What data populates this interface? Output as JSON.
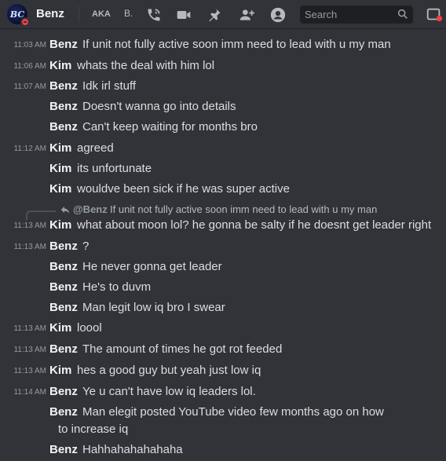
{
  "header": {
    "avatar_initials": "BC",
    "name": "Benz",
    "aka_label": "AKA",
    "aka_value": "B.",
    "search_placeholder": "Search"
  },
  "icons": {
    "call": "phone-call-icon",
    "video": "video-camera-icon",
    "pin": "pin-icon",
    "add_friend": "add-friend-icon",
    "profile": "user-profile-icon",
    "search": "search-icon",
    "inbox": "inbox-icon"
  },
  "colors": {
    "background": "#313338",
    "status_dnd": "#f23f43",
    "text": "#dbdee1",
    "muted": "#949ba4"
  },
  "messages": [
    {
      "time": "11:03 AM",
      "author": "Benz",
      "text": "If unit not fully active soon imm need to lead with u my man"
    },
    {
      "time": "11:06 AM",
      "author": "Kim",
      "text": "whats the deal with him lol"
    },
    {
      "time": "11:07 AM",
      "author": "Benz",
      "text": "Idk irl stuff"
    },
    {
      "time": "",
      "author": "Benz",
      "text": "Doesn't wanna go into details"
    },
    {
      "time": "",
      "author": "Benz",
      "text": "Can't keep waiting for months bro"
    },
    {
      "time": "11:12 AM",
      "author": "Kim",
      "text": "agreed"
    },
    {
      "time": "",
      "author": "Kim",
      "text": "its unfortunate"
    },
    {
      "time": "",
      "author": "Kim",
      "text": "wouldve been sick if he was super active"
    },
    {
      "time": "11:13 AM",
      "author": "Kim",
      "text": "what about moon lol? he gonna be salty if he doesnt get leader right",
      "reply": {
        "author": "@Benz",
        "text": "If unit not fully active soon imm need to lead with u my man"
      }
    },
    {
      "time": "11:13 AM",
      "author": "Benz",
      "text": "?"
    },
    {
      "time": "",
      "author": "Benz",
      "text": "He never gonna get leader"
    },
    {
      "time": "",
      "author": "Benz",
      "text": "He's to duvm"
    },
    {
      "time": "",
      "author": "Benz",
      "text": "Man legit low iq bro I swear"
    },
    {
      "time": "11:13 AM",
      "author": "Kim",
      "text": "loool"
    },
    {
      "time": "11:13 AM",
      "author": "Benz",
      "text": "The amount of times he got rot feeded"
    },
    {
      "time": "11:13 AM",
      "author": "Kim",
      "text": "hes a good guy but yeah just low iq"
    },
    {
      "time": "11:14 AM",
      "author": "Benz",
      "text": "Ye u can't have low iq leaders lol."
    },
    {
      "time": "",
      "author": "Benz",
      "text": "Man elegit posted YouTube video few months ago on how to increase iq"
    },
    {
      "time": "",
      "author": "Benz",
      "text": "Hahhahahahahaha"
    }
  ]
}
